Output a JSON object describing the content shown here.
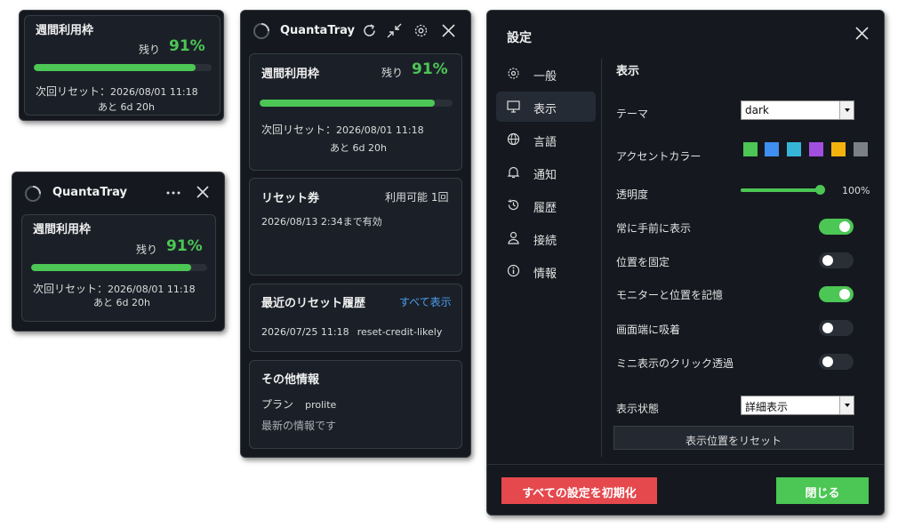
{
  "mini_widget": {
    "usage_title": "週間利用枠",
    "remaining_label": "残り",
    "percent": "91%",
    "progress": 0.91,
    "reset_label": "次回リセット：",
    "reset_date": "2026/08/01 11:18",
    "countdown": "あと 6d 20h"
  },
  "compact_window": {
    "app_title": "QuantaTray",
    "usage_title": "週間利用枠",
    "remaining_label": "残り",
    "percent": "91%",
    "progress": 0.91,
    "reset_label": "次回リセット：",
    "reset_date": "2026/08/01 11:18",
    "countdown": "あと 6d 20h"
  },
  "main_window": {
    "app_title": "QuantaTray",
    "usage": {
      "title": "週間利用枠",
      "remaining_label": "残り",
      "percent": "91%",
      "progress": 0.91,
      "reset_label": "次回リセット：",
      "reset_date": "2026/08/01 11:18",
      "countdown": "あと 6d 20h"
    },
    "reset_ticket": {
      "title": "リセット券",
      "available": "利用可能 1回",
      "validity": "2026/08/13 2:34まで有効"
    },
    "history": {
      "title": "最近のリセット履歴",
      "show_all": "すべて表示",
      "entry_date": "2026/07/25 11:18",
      "entry_name": "reset-credit-likely"
    },
    "other": {
      "title": "その他情報",
      "plan_label": "プラン",
      "plan_value": "prolite",
      "status": "最新の情報です"
    }
  },
  "settings": {
    "title": "設定",
    "nav": [
      {
        "label": "一般",
        "icon": "gear-icon"
      },
      {
        "label": "表示",
        "icon": "monitor-icon"
      },
      {
        "label": "言語",
        "icon": "globe-icon"
      },
      {
        "label": "通知",
        "icon": "bell-icon"
      },
      {
        "label": "履歴",
        "icon": "history-icon"
      },
      {
        "label": "接続",
        "icon": "user-icon"
      },
      {
        "label": "情報",
        "icon": "info-icon"
      }
    ],
    "section_title": "表示",
    "theme_label": "テーマ",
    "theme_value": "dark",
    "accent_label": "アクセントカラー",
    "accent_colors": [
      "#4cc654",
      "#3f8ef0",
      "#35b6d8",
      "#a24fe0",
      "#f5b20f",
      "#7b8088"
    ],
    "opacity_label": "透明度",
    "opacity_value": "100%",
    "opacity_fraction": 1.0,
    "toggles": [
      {
        "label": "常に手前に表示",
        "on": true
      },
      {
        "label": "位置を固定",
        "on": false
      },
      {
        "label": "モニターと位置を記憶",
        "on": true
      },
      {
        "label": "画面端に吸着",
        "on": false
      },
      {
        "label": "ミニ表示のクリック透過",
        "on": false
      }
    ],
    "display_state_label": "表示状態",
    "display_state_value": "詳細表示",
    "reset_position_button": "表示位置をリセット",
    "reset_all_button": "すべての設定を初期化",
    "close_button": "閉じる"
  }
}
